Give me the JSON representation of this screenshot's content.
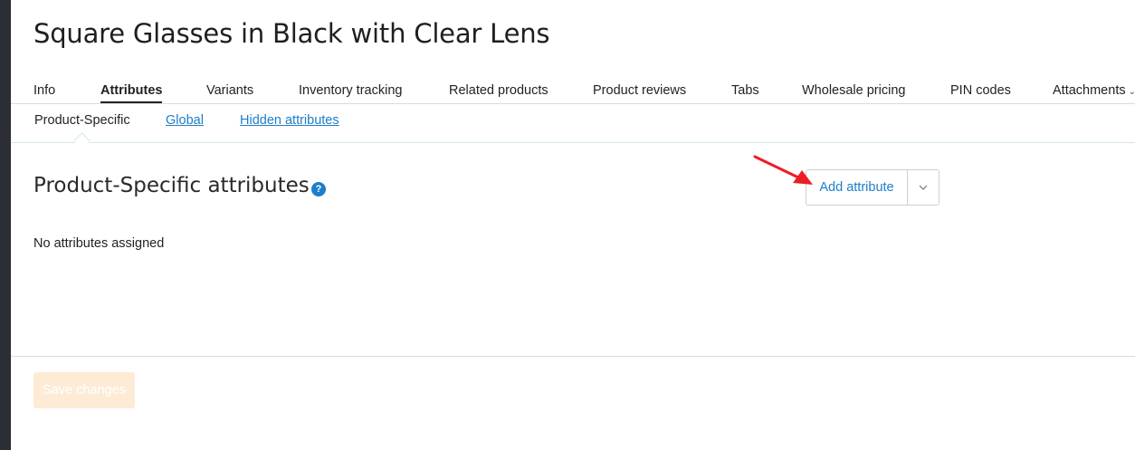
{
  "product": {
    "title": "Square Glasses in Black with Clear Lens"
  },
  "tabs": [
    {
      "label": "Info"
    },
    {
      "label": "Attributes"
    },
    {
      "label": "Variants"
    },
    {
      "label": "Inventory tracking"
    },
    {
      "label": "Related products"
    },
    {
      "label": "Product reviews"
    },
    {
      "label": "Tabs"
    },
    {
      "label": "Wholesale pricing"
    },
    {
      "label": "PIN codes"
    },
    {
      "label": "Attachments"
    }
  ],
  "active_tab": "Attributes",
  "subtabs": [
    {
      "label": "Product-Specific"
    },
    {
      "label": "Global"
    },
    {
      "label": "Hidden attributes"
    }
  ],
  "active_subtab": "Product-Specific",
  "section": {
    "title": "Product-Specific attributes",
    "help_icon": "?",
    "empty_text": "No attributes assigned"
  },
  "actions": {
    "add_attribute": "Add attribute",
    "dropdown_icon": "chevron-down-icon"
  },
  "footer": {
    "save_label": "Save changes"
  },
  "colors": {
    "accent": "#1e7ec8",
    "save_button_disabled": "#fdebd6",
    "annotation_arrow": "#ee1c24"
  }
}
